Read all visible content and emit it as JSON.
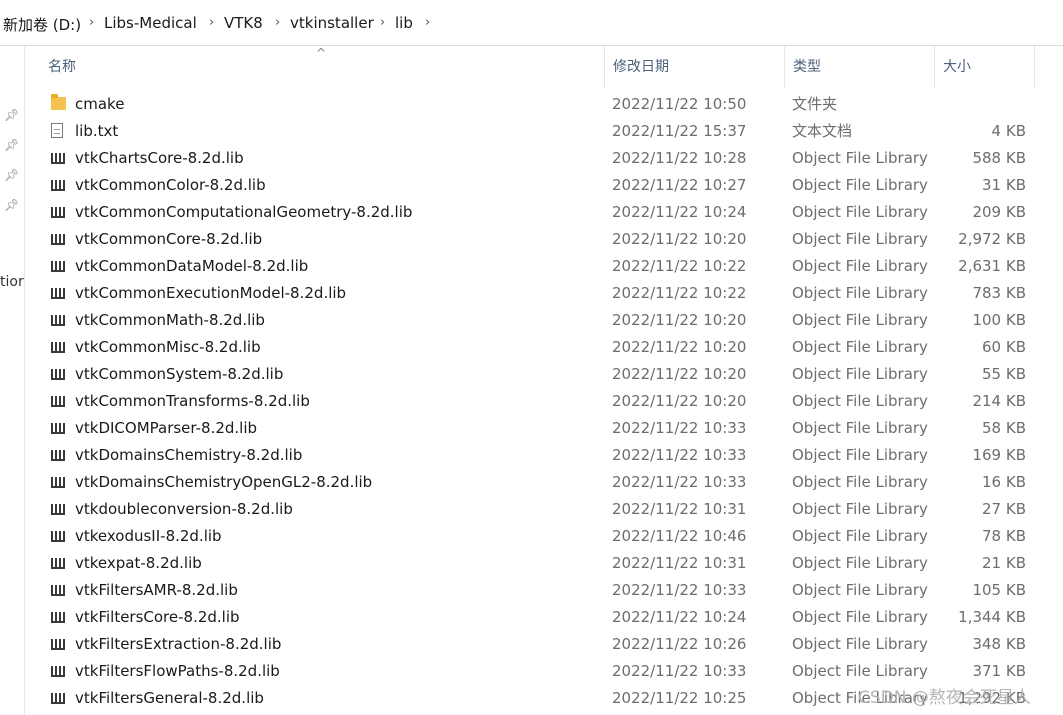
{
  "breadcrumb": {
    "items": [
      "新加卷 (D:)",
      "Libs-Medical",
      "VTK8",
      "vtkinstaller",
      "lib"
    ],
    "separator": "›"
  },
  "nav": {
    "pins": [
      "📌",
      "📌",
      "📌",
      "📌"
    ],
    "partial_label": "tior"
  },
  "columns": {
    "name": "名称",
    "date": "修改日期",
    "type": "类型",
    "size": "大小",
    "sort_indicator": "^"
  },
  "files": [
    {
      "icon": "folder-icon",
      "name": "cmake",
      "date": "2022/11/22 10:50",
      "type": "文件夹",
      "size": ""
    },
    {
      "icon": "text-file-icon",
      "name": "lib.txt",
      "date": "2022/11/22 15:37",
      "type": "文本文档",
      "size": "4 KB"
    },
    {
      "icon": "library-file-icon",
      "name": "vtkChartsCore-8.2d.lib",
      "date": "2022/11/22 10:28",
      "type": "Object File Library",
      "size": "588 KB"
    },
    {
      "icon": "library-file-icon",
      "name": "vtkCommonColor-8.2d.lib",
      "date": "2022/11/22 10:27",
      "type": "Object File Library",
      "size": "31 KB"
    },
    {
      "icon": "library-file-icon",
      "name": "vtkCommonComputationalGeometry-8.2d.lib",
      "date": "2022/11/22 10:24",
      "type": "Object File Library",
      "size": "209 KB"
    },
    {
      "icon": "library-file-icon",
      "name": "vtkCommonCore-8.2d.lib",
      "date": "2022/11/22 10:20",
      "type": "Object File Library",
      "size": "2,972 KB"
    },
    {
      "icon": "library-file-icon",
      "name": "vtkCommonDataModel-8.2d.lib",
      "date": "2022/11/22 10:22",
      "type": "Object File Library",
      "size": "2,631 KB"
    },
    {
      "icon": "library-file-icon",
      "name": "vtkCommonExecutionModel-8.2d.lib",
      "date": "2022/11/22 10:22",
      "type": "Object File Library",
      "size": "783 KB"
    },
    {
      "icon": "library-file-icon",
      "name": "vtkCommonMath-8.2d.lib",
      "date": "2022/11/22 10:20",
      "type": "Object File Library",
      "size": "100 KB"
    },
    {
      "icon": "library-file-icon",
      "name": "vtkCommonMisc-8.2d.lib",
      "date": "2022/11/22 10:20",
      "type": "Object File Library",
      "size": "60 KB"
    },
    {
      "icon": "library-file-icon",
      "name": "vtkCommonSystem-8.2d.lib",
      "date": "2022/11/22 10:20",
      "type": "Object File Library",
      "size": "55 KB"
    },
    {
      "icon": "library-file-icon",
      "name": "vtkCommonTransforms-8.2d.lib",
      "date": "2022/11/22 10:20",
      "type": "Object File Library",
      "size": "214 KB"
    },
    {
      "icon": "library-file-icon",
      "name": "vtkDICOMParser-8.2d.lib",
      "date": "2022/11/22 10:33",
      "type": "Object File Library",
      "size": "58 KB"
    },
    {
      "icon": "library-file-icon",
      "name": "vtkDomainsChemistry-8.2d.lib",
      "date": "2022/11/22 10:33",
      "type": "Object File Library",
      "size": "169 KB"
    },
    {
      "icon": "library-file-icon",
      "name": "vtkDomainsChemistryOpenGL2-8.2d.lib",
      "date": "2022/11/22 10:33",
      "type": "Object File Library",
      "size": "16 KB"
    },
    {
      "icon": "library-file-icon",
      "name": "vtkdoubleconversion-8.2d.lib",
      "date": "2022/11/22 10:31",
      "type": "Object File Library",
      "size": "27 KB"
    },
    {
      "icon": "library-file-icon",
      "name": "vtkexodusII-8.2d.lib",
      "date": "2022/11/22 10:46",
      "type": "Object File Library",
      "size": "78 KB"
    },
    {
      "icon": "library-file-icon",
      "name": "vtkexpat-8.2d.lib",
      "date": "2022/11/22 10:31",
      "type": "Object File Library",
      "size": "21 KB"
    },
    {
      "icon": "library-file-icon",
      "name": "vtkFiltersAMR-8.2d.lib",
      "date": "2022/11/22 10:33",
      "type": "Object File Library",
      "size": "105 KB"
    },
    {
      "icon": "library-file-icon",
      "name": "vtkFiltersCore-8.2d.lib",
      "date": "2022/11/22 10:24",
      "type": "Object File Library",
      "size": "1,344 KB"
    },
    {
      "icon": "library-file-icon",
      "name": "vtkFiltersExtraction-8.2d.lib",
      "date": "2022/11/22 10:26",
      "type": "Object File Library",
      "size": "348 KB"
    },
    {
      "icon": "library-file-icon",
      "name": "vtkFiltersFlowPaths-8.2d.lib",
      "date": "2022/11/22 10:33",
      "type": "Object File Library",
      "size": "371 KB"
    },
    {
      "icon": "library-file-icon",
      "name": "vtkFiltersGeneral-8.2d.lib",
      "date": "2022/11/22 10:25",
      "type": "Object File Library",
      "size": "1,292 KB"
    }
  ],
  "watermark": "CSDN @熬夜会死星人"
}
